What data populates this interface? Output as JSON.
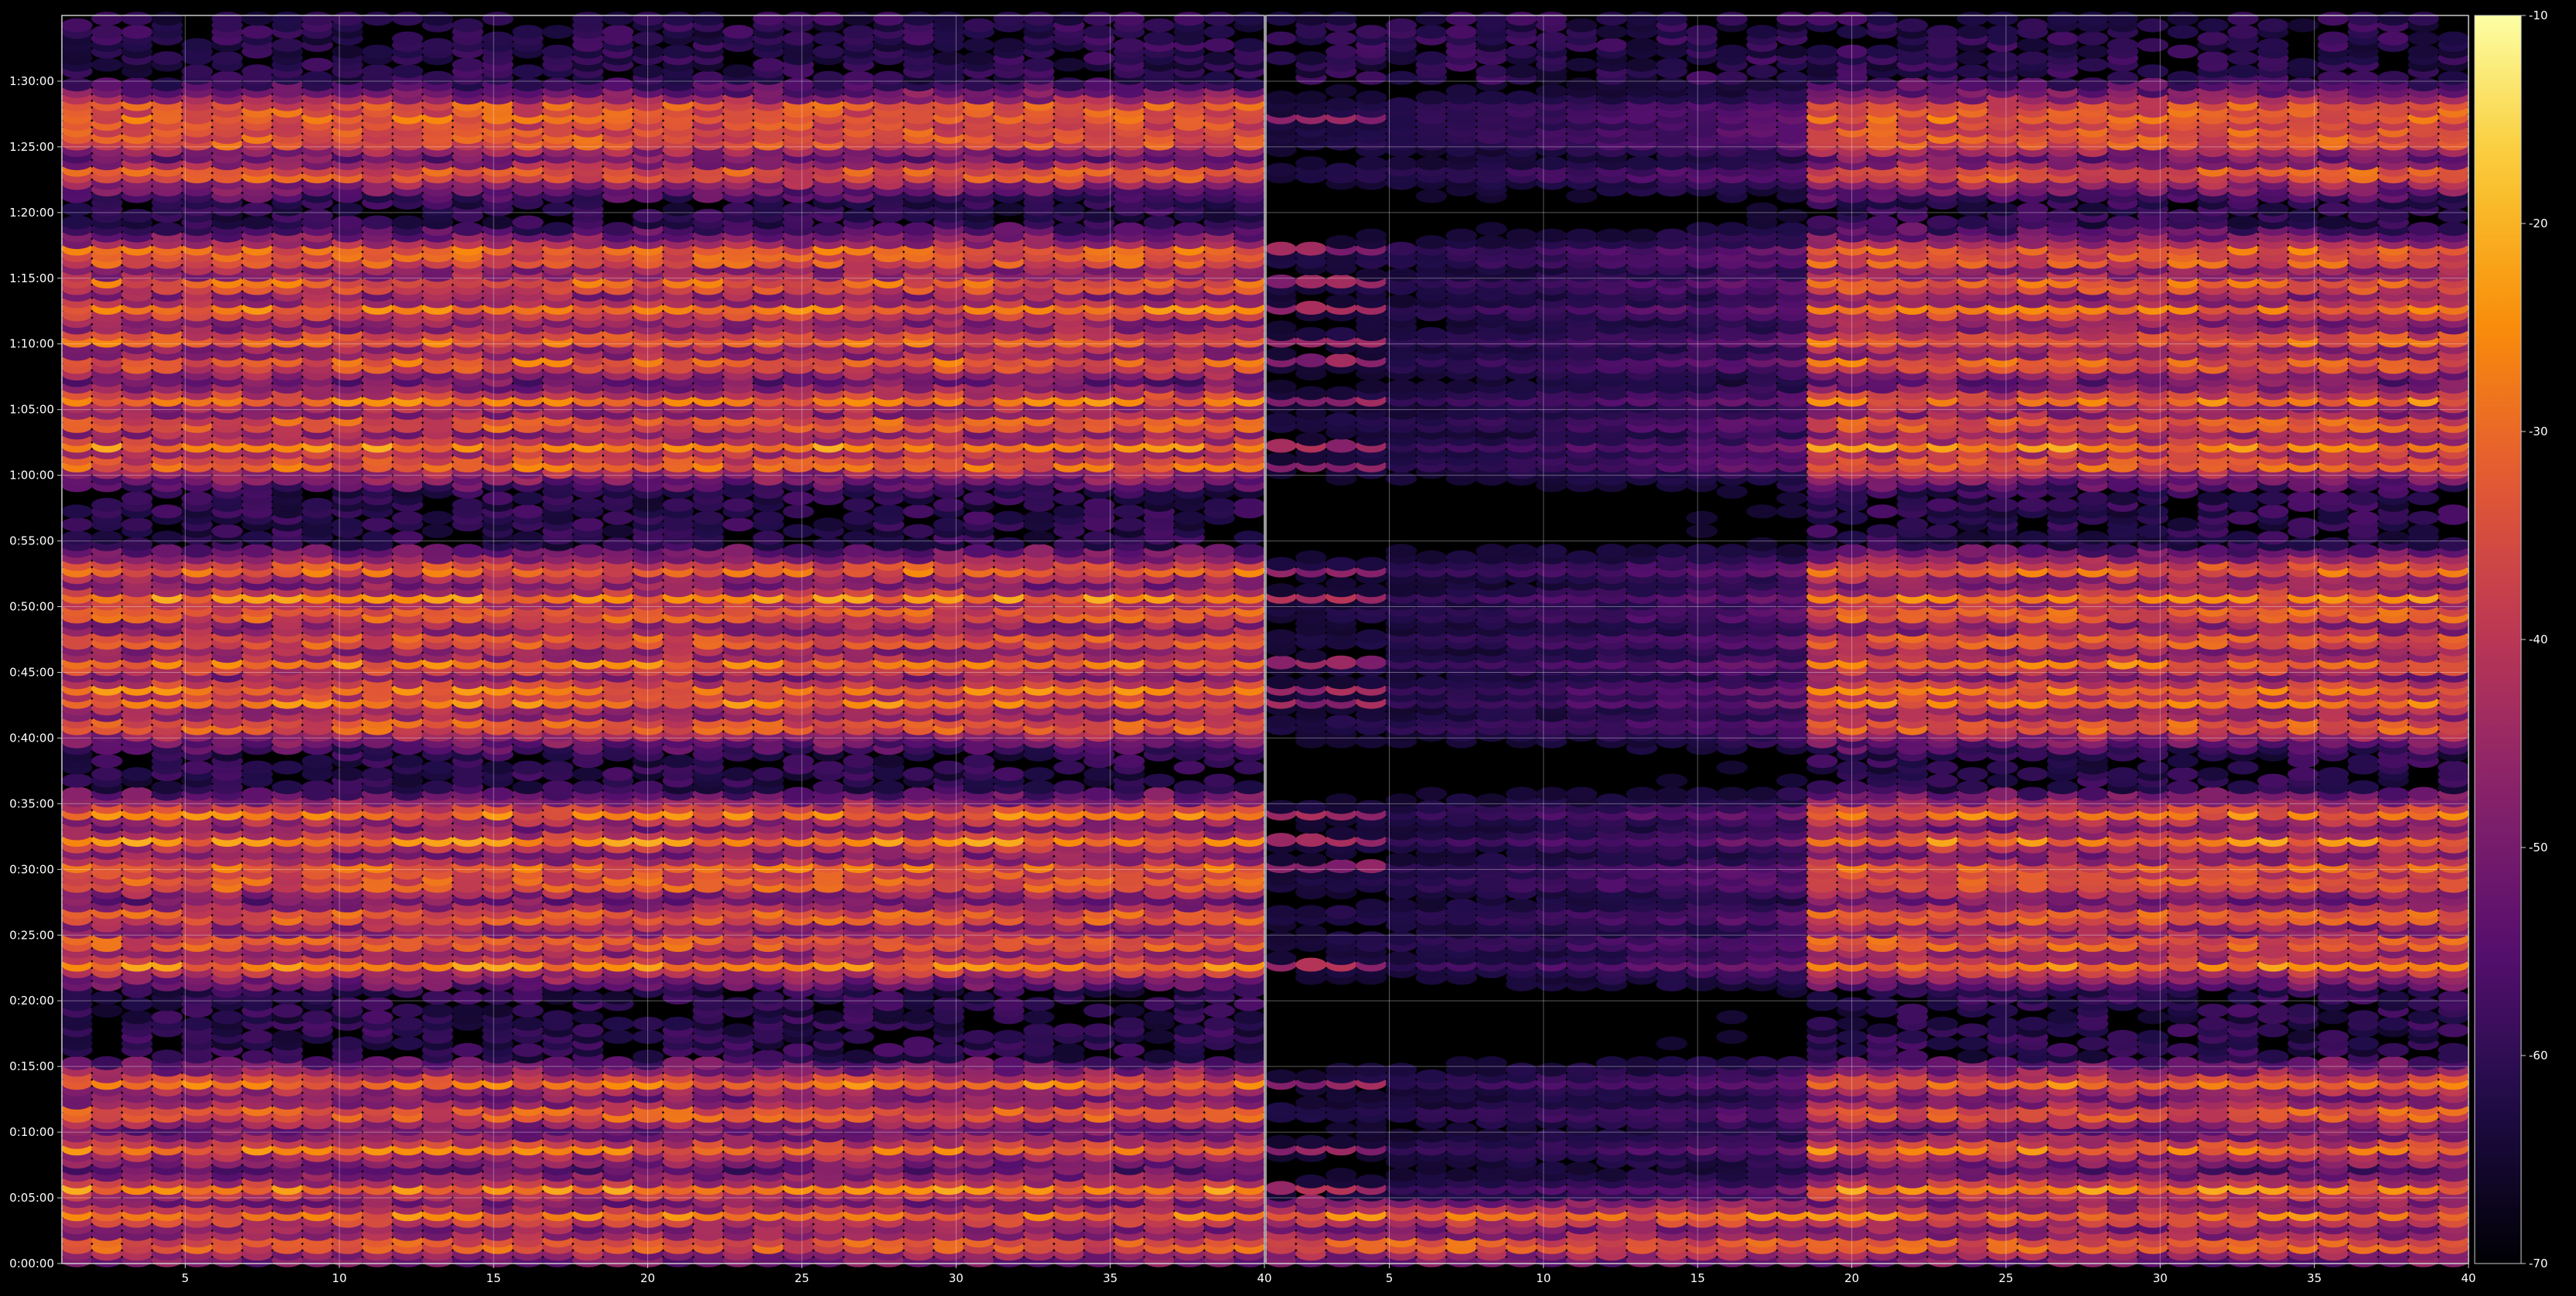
{
  "chart_data": {
    "type": "heatmap",
    "title": "",
    "colormap": "inferno",
    "background": "#000000",
    "grid": true,
    "panels": [
      {
        "name": "",
        "x_ticks": [
          5,
          10,
          15,
          20,
          25,
          30,
          35,
          40
        ],
        "xlim": [
          1,
          40
        ]
      },
      {
        "name": "",
        "x_ticks": [
          5,
          10,
          15,
          20,
          25,
          30,
          35,
          40
        ],
        "xlim": [
          1,
          40
        ]
      }
    ],
    "y_ticks": [
      "0:00:00",
      "0:05:00",
      "0:10:00",
      "0:15:00",
      "0:20:00",
      "0:25:00",
      "0:30:00",
      "0:35:00",
      "0:40:00",
      "0:45:00",
      "0:50:00",
      "0:55:00",
      "1:00:00",
      "1:05:00",
      "1:10:00",
      "1:15:00",
      "1:20:00",
      "1:25:00",
      "1:30:00"
    ],
    "ylim_seconds": [
      0,
      5700
    ],
    "colorbar": {
      "ticks": [
        -10,
        -20,
        -30,
        -40,
        -50,
        -60,
        -70
      ],
      "range": [
        -70,
        -10
      ]
    },
    "strong_rows_seconds": [
      90,
      220,
      345,
      530,
      690,
      830,
      1365,
      1470,
      1590,
      1740,
      1805,
      1935,
      2060,
      2460,
      2570,
      2630,
      2740,
      2850,
      2970,
      3045,
      3175,
      3655,
      3735,
      3840,
      3950,
      4115,
      4225,
      4360,
      4475,
      4590,
      4625,
      4980,
      5130,
      5160,
      5225,
      5280
    ]
  }
}
